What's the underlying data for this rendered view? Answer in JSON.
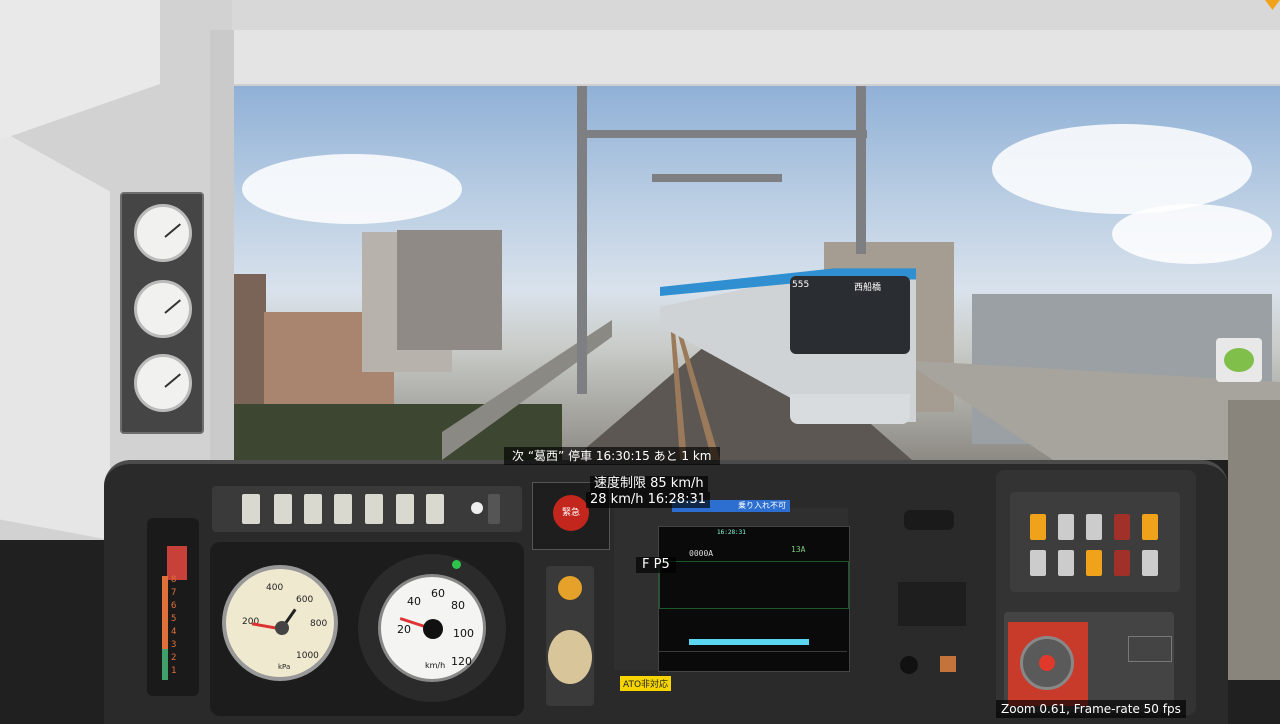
{
  "hud": {
    "next_stop": "次 “葛西” 停車 16:30:15 あと 1 km",
    "speed_limit": "速度制限 85 km/h",
    "speed_time": "28 km/h  16:28:31",
    "mode": "F  P5",
    "zoom_fps": "Zoom 0.61, Frame-rate 50 fps"
  },
  "cab": {
    "emergency_label": "緊急",
    "ato_label": "ATO非対応",
    "pressure_unit": "kPa",
    "speed_unit": "km/h",
    "blue_sign": "乗り入れ不可",
    "train_destination": "西船橋",
    "train_number": "555"
  },
  "monitor": {
    "code": "0000A",
    "track": "13A",
    "header": "16:28:31"
  },
  "pressure_gauge": {
    "ticks": [
      "200",
      "400",
      "600",
      "800",
      "1000"
    ]
  },
  "speedometer": {
    "ticks": [
      "20",
      "40",
      "60",
      "80",
      "100",
      "120"
    ],
    "current_speed": 28
  },
  "notch_indicator": {
    "levels": [
      "8",
      "7",
      "6",
      "5",
      "4",
      "3",
      "2",
      "1"
    ]
  },
  "colors": {
    "console": "#2a2a2a",
    "train_accent": "#2f8fd0",
    "warning_orange": "#f0a21a"
  }
}
